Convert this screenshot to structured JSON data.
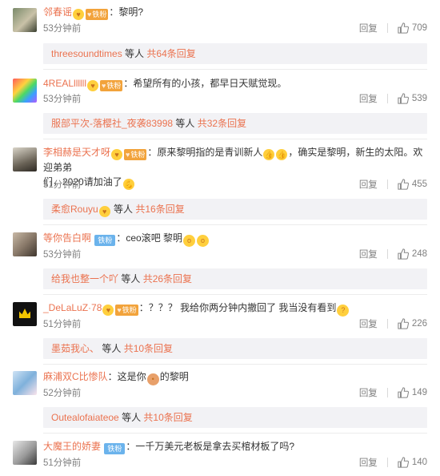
{
  "comments": [
    {
      "username": "邻春谣",
      "badge": "铁粉",
      "text": "：黎明?",
      "time": "53分钟前",
      "reply_label": "回复",
      "likes": "709",
      "replies": {
        "who": "threesoundtimes",
        "mid": " 等人 ",
        "count": "共64条回复"
      }
    },
    {
      "username": "4REALllllll",
      "badge": "铁粉",
      "text": "：希望所有的小孩，都早日天赋觉现。",
      "time": "53分钟前",
      "reply_label": "回复",
      "likes": "539",
      "replies": {
        "who": "服部平次-落樱社_夜袭83998",
        "mid": " 等人 ",
        "count": "共32条回复"
      }
    },
    {
      "username": "李相赫是天才呀",
      "badge": "铁粉",
      "text_a": "：原来黎明指的是青训新人",
      "text_b": "，确实是黎明，新生的太阳。欢迎弟弟",
      "text_c": "们，2020请加油了",
      "time": "51分钟前",
      "reply_label": "回复",
      "likes": "455",
      "replies": {
        "who": "柔愈Rouyu",
        "mid": " 等人 ",
        "count": "共16条回复"
      }
    },
    {
      "username": "等你告白啊",
      "badge": "铁粉",
      "text": "：ceo滚吧 黎明",
      "time": "53分钟前",
      "reply_label": "回复",
      "likes": "248",
      "replies": {
        "who": "给我也整一个吖",
        "mid": " 等人 ",
        "count": "共26条回复"
      }
    },
    {
      "username": "_DeLaLuZ·78",
      "badge": "铁粉",
      "text": "：？？？ 我给你两分钟内撤回了 我当没有看到",
      "time": "51分钟前",
      "reply_label": "回复",
      "likes": "226",
      "replies": {
        "who": "墨茹我心、",
        "mid": " 等人 ",
        "count": "共10条回复"
      }
    },
    {
      "username": "麻浦双C比惨队",
      "text_a": "：这是你",
      "text_b": "的黎明",
      "time": "52分钟前",
      "reply_label": "回复",
      "likes": "149",
      "replies": {
        "who": "Outealofaiateoe",
        "mid": " 等人 ",
        "count": "共10条回复"
      }
    },
    {
      "username": "大魔王的娇妻",
      "badge": "铁粉",
      "text": "：一千万美元老板是拿去买棺材板了吗?",
      "time": "51分钟前",
      "reply_label": "回复",
      "likes": "140"
    }
  ],
  "colors": {
    "username": "#eb7350",
    "meta": "#808080",
    "reply_bg": "#f2f2f5",
    "badge": "#f59a4d",
    "badge_blue": "#6bb3ec"
  }
}
